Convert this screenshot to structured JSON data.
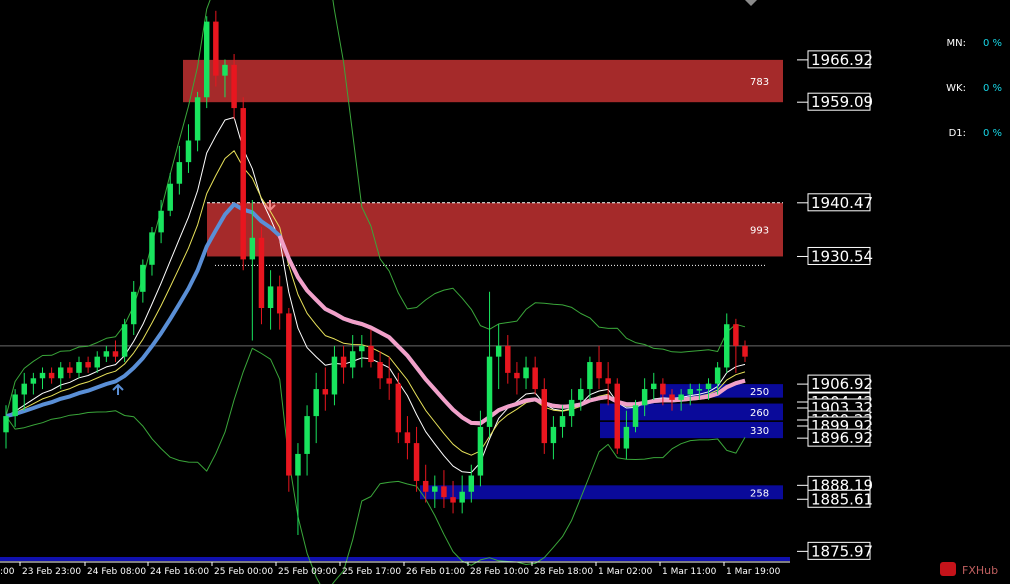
{
  "colors": {
    "background": "#000000",
    "bull": "#19e45e",
    "bear": "#e8161f",
    "supply_zone": "#a52a2a",
    "demand_zone": "#0a0a9a",
    "ma_pink": "#f2a0c8",
    "ma_blue": "#5a8fd6",
    "band_green": "#3aa63a",
    "line_white": "#ffffff",
    "line_yellow": "#e8e25a",
    "stat_value": "#17d6e6"
  },
  "stats": [
    {
      "key": "MN:",
      "value": "0 %"
    },
    {
      "key": "WK:",
      "value": "0 %"
    },
    {
      "key": "D1:",
      "value": "0 %"
    }
  ],
  "price_labels": [
    "1966.92",
    "1959.09",
    "1940.47",
    "1930.54",
    "1906.92",
    "1904.42",
    "1903.32",
    "1900.22",
    "1899.92",
    "1896.92",
    "1888.19",
    "1885.61",
    "1875.97"
  ],
  "watermark": "FXHub",
  "chart_data": {
    "type": "candlestick",
    "y_range": [
      1874,
      1978
    ],
    "x_labels": [
      "23 Feb 23:00",
      "24 Feb 08:00",
      "24 Feb 16:00",
      "25 Feb 00:00",
      "25 Feb 09:00",
      "25 Feb 17:00",
      "26 Feb 01:00",
      "28 Feb 10:00",
      "28 Feb 18:00",
      "1 Mar 02:00",
      "1 Mar 11:00",
      "1 Mar 19:00"
    ],
    "x_label_first_partial": ":00",
    "zones": [
      {
        "kind": "supply",
        "top": 1966.92,
        "bottom": 1959.09,
        "label": "783"
      },
      {
        "kind": "supply",
        "top": 1940.47,
        "bottom": 1930.54,
        "label": "993"
      },
      {
        "kind": "demand",
        "top": 1906.92,
        "bottom": 1904.42,
        "label": "250"
      },
      {
        "kind": "demand",
        "top": 1903.32,
        "bottom": 1900.22,
        "label": "260"
      },
      {
        "kind": "demand",
        "top": 1899.92,
        "bottom": 1896.92,
        "label": "330"
      },
      {
        "kind": "demand",
        "top": 1888.19,
        "bottom": 1885.61,
        "label": "258"
      }
    ],
    "horizontal_lines": [
      {
        "price": 1940.47,
        "style": "dashed"
      },
      {
        "price": 1928.9,
        "style": "dotted"
      },
      {
        "price": 1914.0,
        "style": "solid-gray"
      }
    ],
    "candles": [
      [
        1898,
        1903,
        1895,
        1901
      ],
      [
        1901,
        1906,
        1899,
        1905
      ],
      [
        1905,
        1909,
        1902,
        1907
      ],
      [
        1907,
        1909,
        1905,
        1908
      ],
      [
        1908,
        1910,
        1906,
        1909
      ],
      [
        1909,
        1910,
        1907,
        1908
      ],
      [
        1908,
        1911,
        1906,
        1910
      ],
      [
        1910,
        1911,
        1908,
        1909
      ],
      [
        1909,
        1912,
        1908,
        1911
      ],
      [
        1911,
        1912,
        1909,
        1910
      ],
      [
        1910,
        1913,
        1909,
        1912
      ],
      [
        1912,
        1914,
        1911,
        1913
      ],
      [
        1913,
        1915,
        1911,
        1912
      ],
      [
        1912,
        1919,
        1911,
        1918
      ],
      [
        1918,
        1926,
        1916,
        1924
      ],
      [
        1924,
        1930,
        1922,
        1929
      ],
      [
        1929,
        1936,
        1927,
        1935
      ],
      [
        1935,
        1941,
        1933,
        1939
      ],
      [
        1939,
        1946,
        1938,
        1944
      ],
      [
        1944,
        1951,
        1942,
        1948
      ],
      [
        1948,
        1955,
        1946,
        1952
      ],
      [
        1952,
        1961,
        1950,
        1960
      ],
      [
        1960,
        1975,
        1958,
        1974
      ],
      [
        1974,
        1976,
        1962,
        1964
      ],
      [
        1964,
        1967,
        1960,
        1966
      ],
      [
        1966,
        1968,
        1956,
        1958
      ],
      [
        1958,
        1960,
        1928,
        1930
      ],
      [
        1930,
        1941,
        1915,
        1934
      ],
      [
        1934,
        1936,
        1918,
        1921
      ],
      [
        1921,
        1928,
        1917,
        1925
      ],
      [
        1925,
        1927,
        1917,
        1920
      ],
      [
        1920,
        1921,
        1887,
        1890
      ],
      [
        1890,
        1896,
        1879,
        1894
      ],
      [
        1894,
        1903,
        1890,
        1901
      ],
      [
        1901,
        1909,
        1896,
        1906
      ],
      [
        1906,
        1910,
        1902,
        1905
      ],
      [
        1905,
        1914,
        1903,
        1912
      ],
      [
        1912,
        1914,
        1907,
        1910
      ],
      [
        1910,
        1916,
        1908,
        1913
      ],
      [
        1913,
        1916,
        1910,
        1914
      ],
      [
        1914,
        1917,
        1910,
        1911
      ],
      [
        1911,
        1913,
        1906,
        1908
      ],
      [
        1908,
        1912,
        1904,
        1907
      ],
      [
        1907,
        1909,
        1896,
        1898
      ],
      [
        1898,
        1901,
        1893,
        1896
      ],
      [
        1896,
        1899,
        1887,
        1889
      ],
      [
        1889,
        1892,
        1885,
        1887
      ],
      [
        1887,
        1890,
        1884,
        1888
      ],
      [
        1888,
        1891,
        1884,
        1886
      ],
      [
        1886,
        1889,
        1883,
        1885
      ],
      [
        1885,
        1890,
        1883,
        1887
      ],
      [
        1887,
        1892,
        1885,
        1890
      ],
      [
        1890,
        1902,
        1888,
        1899
      ],
      [
        1899,
        1924,
        1897,
        1912
      ],
      [
        1912,
        1918,
        1906,
        1914
      ],
      [
        1914,
        1916,
        1907,
        1909
      ],
      [
        1909,
        1911,
        1905,
        1908
      ],
      [
        1908,
        1912,
        1906,
        1910
      ],
      [
        1910,
        1912,
        1905,
        1906
      ],
      [
        1906,
        1908,
        1894,
        1896
      ],
      [
        1896,
        1901,
        1893,
        1899
      ],
      [
        1899,
        1903,
        1897,
        1901
      ],
      [
        1901,
        1906,
        1899,
        1904
      ],
      [
        1904,
        1908,
        1902,
        1906
      ],
      [
        1906,
        1912,
        1904,
        1911
      ],
      [
        1911,
        1914,
        1906,
        1908
      ],
      [
        1908,
        1911,
        1903,
        1907
      ],
      [
        1907,
        1908,
        1894,
        1895
      ],
      [
        1895,
        1902,
        1893,
        1899
      ],
      [
        1899,
        1904,
        1898,
        1903
      ],
      [
        1903,
        1908,
        1901,
        1906
      ],
      [
        1906,
        1909,
        1904,
        1907
      ],
      [
        1907,
        1908,
        1903,
        1905
      ],
      [
        1905,
        1906,
        1902,
        1904
      ],
      [
        1904,
        1906,
        1902,
        1905
      ],
      [
        1905,
        1907,
        1903,
        1906
      ],
      [
        1906,
        1907,
        1904,
        1906
      ],
      [
        1906,
        1908,
        1904,
        1907
      ],
      [
        1907,
        1911,
        1905,
        1910
      ],
      [
        1910,
        1920,
        1909,
        1918
      ],
      [
        1918,
        1919,
        1909,
        1914
      ],
      [
        1914,
        1915,
        1911,
        1912
      ]
    ]
  }
}
